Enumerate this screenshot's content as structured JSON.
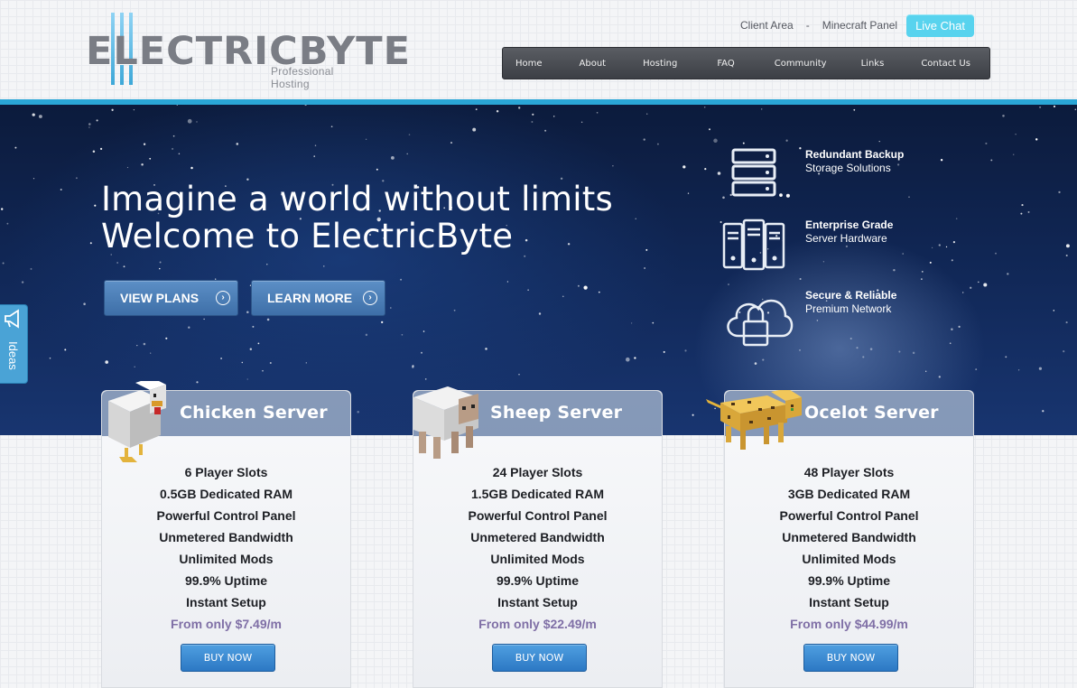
{
  "brand": {
    "logo_text": "ELECTRICBYTE",
    "tagline": "Professional Hosting"
  },
  "toplinks": {
    "client_area": "Client Area",
    "separator": "-",
    "minecraft_panel": "Minecraft Panel",
    "live_chat": "Live Chat"
  },
  "nav": {
    "items": [
      "Home",
      "About",
      "Hosting",
      "FAQ",
      "Community",
      "Links",
      "Contact Us"
    ]
  },
  "hero": {
    "line1": "Imagine a world without limits",
    "line2": "Welcome to ElectricByte",
    "view_plans": "VIEW PLANS",
    "learn_more": "LEARN MORE",
    "features": [
      {
        "title": "Redundant Backup",
        "subtitle": "Storage Solutions",
        "icon": "storage-server-icon"
      },
      {
        "title": "Enterprise Grade",
        "subtitle": "Server Hardware",
        "icon": "server-tower-icon"
      },
      {
        "title": "Secure & Reliable",
        "subtitle": "Premium Network",
        "icon": "cloud-lock-icon"
      }
    ]
  },
  "ideas_tab": {
    "label": "Ideas",
    "icon": "megaphone-icon"
  },
  "plans": [
    {
      "name": "Chicken Server",
      "features": [
        "6 Player Slots",
        "0.5GB Dedicated RAM",
        "Powerful Control Panel",
        "Unmetered Bandwidth",
        "Unlimited Mods",
        "99.9% Uptime",
        "Instant Setup"
      ],
      "price": "From only $7.49/m",
      "button": "BUY NOW"
    },
    {
      "name": "Sheep Server",
      "features": [
        "24 Player Slots",
        "1.5GB Dedicated RAM",
        "Powerful Control Panel",
        "Unmetered Bandwidth",
        "Unlimited Mods",
        "99.9% Uptime",
        "Instant Setup"
      ],
      "price": "From only $22.49/m",
      "button": "BUY NOW"
    },
    {
      "name": "Ocelot Server",
      "features": [
        "48 Player Slots",
        "3GB Dedicated RAM",
        "Powerful Control Panel",
        "Unmetered Bandwidth",
        "Unlimited Mods",
        "99.9% Uptime",
        "Instant Setup"
      ],
      "price": "From only $44.99/m",
      "button": "BUY NOW"
    }
  ],
  "colors": {
    "accent": "#2aa6d6",
    "live_chat": "#58d3ee",
    "price": "#7f6fa6",
    "buy_button": "#2c78c4"
  }
}
